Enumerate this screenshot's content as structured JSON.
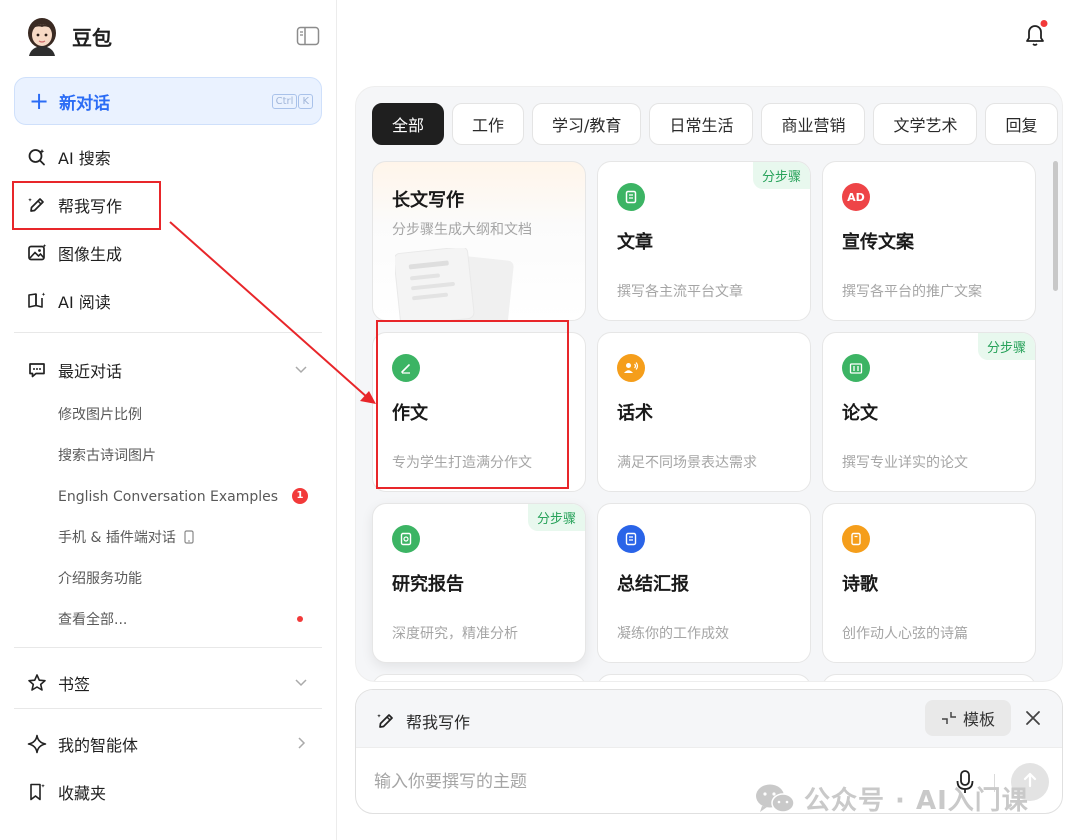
{
  "app": {
    "brand": "豆包",
    "new_chat": "新对话",
    "shortcut": [
      "Ctrl",
      "K"
    ]
  },
  "nav": [
    {
      "label": "AI 搜索",
      "icon": "search-sparkle-icon"
    },
    {
      "label": "帮我写作",
      "icon": "pen-icon"
    },
    {
      "label": "图像生成",
      "icon": "image-icon"
    },
    {
      "label": "AI 阅读",
      "icon": "book-icon"
    }
  ],
  "recent": {
    "title": "最近对话",
    "items": [
      "修改图片比例",
      "搜索古诗词图片",
      "English Conversation Examples",
      "手机 & 插件端对话",
      "介绍服务功能",
      "查看全部..."
    ],
    "badge": "1"
  },
  "bookmarks": {
    "title": "书签"
  },
  "agents": {
    "title": "我的智能体"
  },
  "favorites": {
    "title": "收藏夹"
  },
  "tabs": [
    "全部",
    "工作",
    "学习/教育",
    "日常生活",
    "商业营销",
    "文学艺术",
    "回复"
  ],
  "cards": [
    {
      "title": "长文写作",
      "desc": "分步骤生成大纲和文档",
      "tag": ""
    },
    {
      "title": "文章",
      "desc": "撰写各主流平台文章",
      "tag": "分步骤",
      "icon_color": "#3cb464",
      "icon": "article-icon"
    },
    {
      "title": "宣传文案",
      "desc": "撰写各平台的推广文案",
      "tag": "",
      "icon_color": "#ee4447",
      "icon": "ad-icon",
      "icon_text": "AD"
    },
    {
      "title": "作文",
      "desc": "专为学生打造满分作文",
      "tag": "",
      "icon_color": "#3cb464",
      "icon": "essay-pen-icon"
    },
    {
      "title": "话术",
      "desc": "满足不同场景表达需求",
      "tag": "",
      "icon_color": "#f59e1b",
      "icon": "speaker-icon"
    },
    {
      "title": "论文",
      "desc": "撰写专业详实的论文",
      "tag": "分步骤",
      "icon_color": "#3cb464",
      "icon": "thesis-icon"
    },
    {
      "title": "研究报告",
      "desc": "深度研究，精准分析",
      "tag": "分步骤",
      "icon_color": "#3cb464",
      "icon": "report-icon"
    },
    {
      "title": "总结汇报",
      "desc": "凝练你的工作成效",
      "tag": "",
      "icon_color": "#2a64e8",
      "icon": "summary-icon"
    },
    {
      "title": "诗歌",
      "desc": "创作动人心弦的诗篇",
      "tag": "",
      "icon_color": "#f59e1b",
      "icon": "poem-icon"
    }
  ],
  "composer": {
    "skill": "帮我写作",
    "template": "模板",
    "placeholder": "输入你要撰写的主题"
  },
  "watermark": "公众号 · AI入门课"
}
